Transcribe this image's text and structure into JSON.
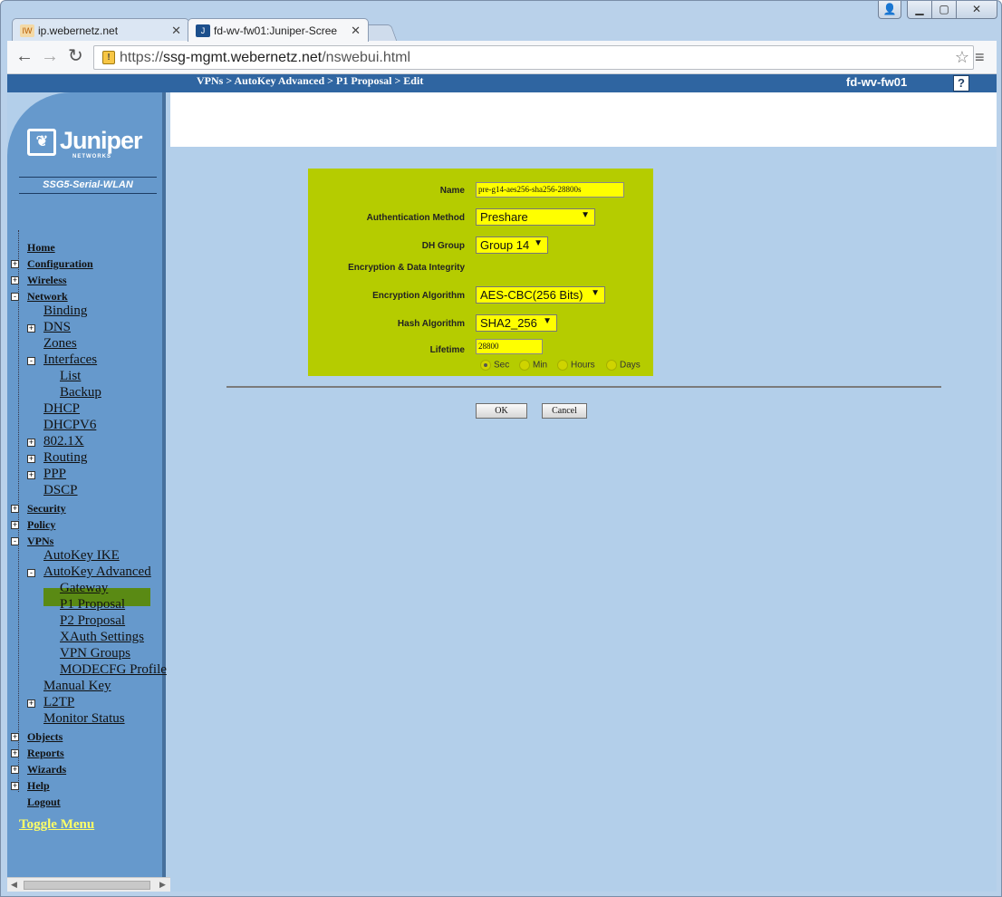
{
  "browser": {
    "tabs": [
      {
        "title": "ip.webernetz.net",
        "favicon": "IW"
      },
      {
        "title": "fd-wv-fw01:Juniper-Scree",
        "favicon": "J"
      }
    ],
    "url_prefix": "https://",
    "url_host": "ssg-mgmt.webernetz.net",
    "url_path": "/nswebui.html"
  },
  "header": {
    "breadcrumb": "VPNs > AutoKey Advanced > P1 Proposal > Edit",
    "hostname": "fd-wv-fw01",
    "help": "?"
  },
  "sidebar": {
    "logo_word": "Juniper",
    "logo_sub": "NETWORKS",
    "model": "SSG5-Serial-WLAN",
    "items": [
      {
        "label": "Home",
        "level": 0,
        "expander": ""
      },
      {
        "label": "Configuration",
        "level": 0,
        "expander": "+"
      },
      {
        "label": "Wireless",
        "level": 0,
        "expander": "+"
      },
      {
        "label": "Network",
        "level": 0,
        "expander": "-"
      },
      {
        "label": "Binding",
        "level": 1,
        "expander": ""
      },
      {
        "label": "DNS",
        "level": 1,
        "expander": "+"
      },
      {
        "label": "Zones",
        "level": 1,
        "expander": ""
      },
      {
        "label": "Interfaces",
        "level": 1,
        "expander": "-"
      },
      {
        "label": "List",
        "level": 2,
        "expander": ""
      },
      {
        "label": "Backup",
        "level": 2,
        "expander": ""
      },
      {
        "label": "DHCP",
        "level": 1,
        "expander": ""
      },
      {
        "label": "DHCPV6",
        "level": 1,
        "expander": ""
      },
      {
        "label": "802.1X",
        "level": 1,
        "expander": "+"
      },
      {
        "label": "Routing",
        "level": 1,
        "expander": "+"
      },
      {
        "label": "PPP",
        "level": 1,
        "expander": "+"
      },
      {
        "label": "DSCP",
        "level": 1,
        "expander": ""
      },
      {
        "label": "Security",
        "level": 0,
        "expander": "+"
      },
      {
        "label": "Policy",
        "level": 0,
        "expander": "+"
      },
      {
        "label": "VPNs",
        "level": 0,
        "expander": "-"
      },
      {
        "label": "AutoKey IKE",
        "level": 1,
        "expander": ""
      },
      {
        "label": "AutoKey Advanced",
        "level": 1,
        "expander": "-"
      },
      {
        "label": "Gateway",
        "level": 2,
        "expander": ""
      },
      {
        "label": "P1 Proposal",
        "level": 2,
        "expander": ""
      },
      {
        "label": "P2 Proposal",
        "level": 2,
        "expander": ""
      },
      {
        "label": "XAuth Settings",
        "level": 2,
        "expander": ""
      },
      {
        "label": "VPN Groups",
        "level": 2,
        "expander": ""
      },
      {
        "label": "MODECFG Profile",
        "level": 2,
        "expander": ""
      },
      {
        "label": "Manual Key",
        "level": 1,
        "expander": ""
      },
      {
        "label": "L2TP",
        "level": 1,
        "expander": "+"
      },
      {
        "label": "Monitor Status",
        "level": 1,
        "expander": ""
      },
      {
        "label": "Objects",
        "level": 0,
        "expander": "+"
      },
      {
        "label": "Reports",
        "level": 0,
        "expander": "+"
      },
      {
        "label": "Wizards",
        "level": 0,
        "expander": "+"
      },
      {
        "label": "Help",
        "level": 0,
        "expander": "+"
      },
      {
        "label": "Logout",
        "level": 0,
        "expander": ""
      }
    ],
    "selected": "P1 Proposal",
    "toggle_menu": "Toggle Menu"
  },
  "form": {
    "name_label": "Name",
    "name_value": "pre-g14-aes256-sha256-28800s",
    "auth_label": "Authentication Method",
    "auth_value": "Preshare",
    "dh_label": "DH Group",
    "dh_value": "Group 14",
    "section_label": "Encryption & Data Integrity",
    "enc_label": "Encryption Algorithm",
    "enc_value": "AES-CBC(256 Bits)",
    "hash_label": "Hash Algorithm",
    "hash_value": "SHA2_256",
    "lifetime_label": "Lifetime",
    "lifetime_value": "28800",
    "units": [
      "Sec",
      "Min",
      "Hours",
      "Days"
    ],
    "unit_selected": "Sec",
    "ok": "OK",
    "cancel": "Cancel"
  },
  "colors": {
    "sidebar_bg": "#6699cc",
    "topbar_bg": "#2f65a1",
    "form_bg": "#b5cc00",
    "field_bg": "#ffff00",
    "selected_bg": "#5a8a14",
    "content_bg": "#b3cfea"
  }
}
